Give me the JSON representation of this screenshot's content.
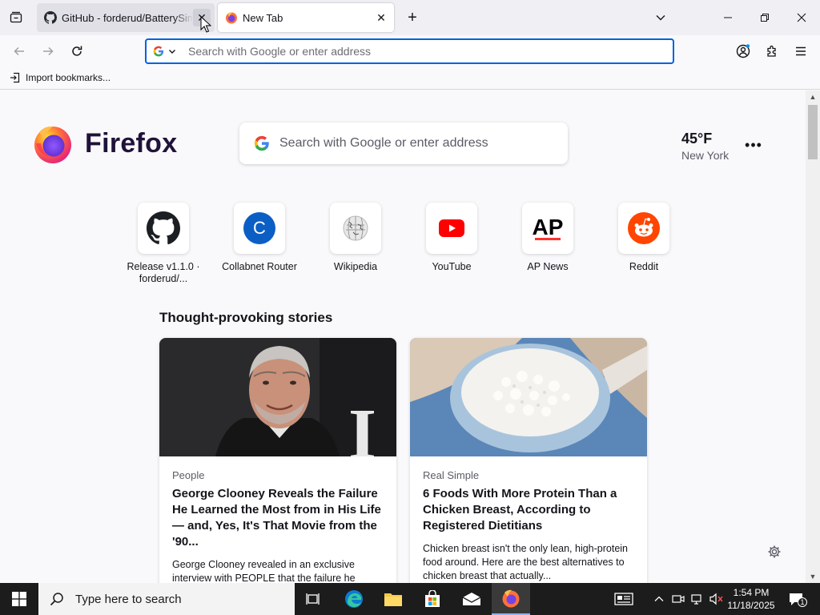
{
  "browser": {
    "tabs": [
      {
        "title": "GitHub - forderud/BatterySim",
        "active": false,
        "favicon": "github-icon"
      },
      {
        "title": "New Tab",
        "active": true,
        "favicon": "firefox-icon"
      }
    ],
    "urlbar": {
      "placeholder": "Search with Google or enter address",
      "value": "",
      "engine": "google-icon"
    },
    "bookmarks": {
      "import_label": "Import bookmarks..."
    }
  },
  "newtab": {
    "brand": "Firefox",
    "search_placeholder": "Search with Google or enter address",
    "weather": {
      "temp": "45°F",
      "city": "New York"
    },
    "shortcuts": [
      {
        "label": "Release v1.1.0 · forderud/...",
        "icon": "github-icon"
      },
      {
        "label": "Collabnet Router",
        "icon": "collabnet-c-icon"
      },
      {
        "label": "Wikipedia",
        "icon": "wikipedia-icon"
      },
      {
        "label": "YouTube",
        "icon": "youtube-icon"
      },
      {
        "label": "AP News",
        "icon": "ap-news-icon"
      },
      {
        "label": "Reddit",
        "icon": "reddit-icon"
      }
    ],
    "section_title": "Thought-provoking stories",
    "stories": [
      {
        "source": "People",
        "headline": "George Clooney Reveals the Failure He Learned the Most from in His Life — and, Yes, It's That Movie from the '90...",
        "excerpt": "George Clooney revealed in an exclusive interview with PEOPLE that the failure he learned the most from in his life is 1997's..."
      },
      {
        "source": "Real Simple",
        "headline": "6 Foods With More Protein Than a Chicken Breast, According to Registered Dietitians",
        "excerpt": "Chicken breast isn't the only lean, high-protein food around. Here are the best alternatives to chicken breast that actually..."
      }
    ]
  },
  "taskbar": {
    "search_placeholder": "Type here to search",
    "time": "1:54 PM",
    "date": "11/18/2025",
    "notification_count": "1"
  }
}
